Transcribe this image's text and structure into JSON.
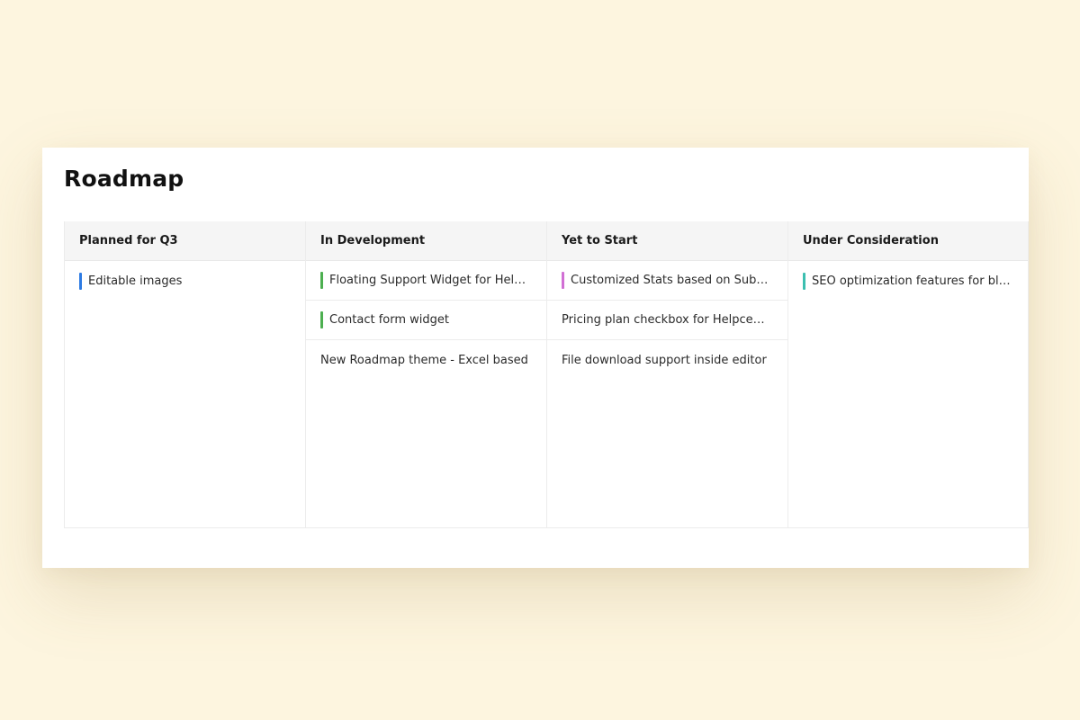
{
  "page_title": "Roadmap",
  "columns": [
    {
      "title": "Planned for Q3",
      "items": [
        {
          "label": "Editable images",
          "tag_color": "#2d7be3"
        }
      ]
    },
    {
      "title": "In Development",
      "items": [
        {
          "label": "Floating Support Widget for Helpcenter",
          "tag_color": "#4caf50"
        },
        {
          "label": "Contact form widget",
          "tag_color": "#4caf50"
        },
        {
          "label": "New Roadmap theme - Excel based",
          "tag_color": null
        }
      ]
    },
    {
      "title": "Yet to Start",
      "items": [
        {
          "label": "Customized Stats based on Subscription",
          "tag_color": "#d16fd4"
        },
        {
          "label": "Pricing plan checkbox for Helpcenter",
          "tag_color": null
        },
        {
          "label": "File download support inside editor",
          "tag_color": null
        }
      ]
    },
    {
      "title": "Under Consideration",
      "items": [
        {
          "label": "SEO optimization features for blog",
          "tag_color": "#3cbfb0"
        }
      ]
    }
  ],
  "colors": {
    "background": "#fdf5df",
    "panel": "#ffffff",
    "header_bg": "#f5f5f5"
  }
}
